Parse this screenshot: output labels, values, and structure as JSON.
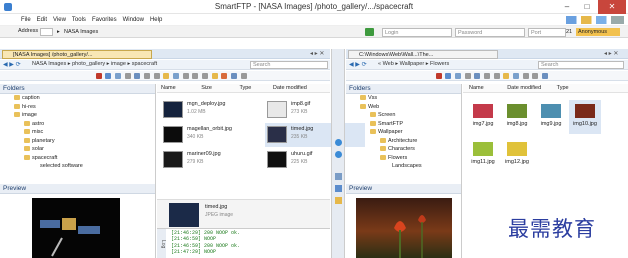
{
  "window": {
    "title": "SmartFTP - [NASA Images] /photo_gallery/.../spacecraft",
    "minimize": "–",
    "maximize": "□",
    "close": "✕"
  },
  "menu": [
    "File",
    "Edit",
    "View",
    "Tools",
    "Favorites",
    "Window",
    "Help"
  ],
  "addressbar": {
    "label": "Address",
    "value": "NASA Images",
    "login_placeholder": "Login",
    "password_placeholder": "Password",
    "port_label": "Port",
    "port_value": "21",
    "anon": "Anonymous"
  },
  "left": {
    "tab": "[NASA Images] /photo_gallery/...",
    "breadcrumb": [
      "NASA Images",
      "photo_gallery",
      "image",
      "spacecraft"
    ],
    "search_placeholder": "Search",
    "folders_title": "Folders",
    "folders": [
      {
        "name": "caption",
        "indent": 1
      },
      {
        "name": "hi-res",
        "indent": 1
      },
      {
        "name": "image",
        "indent": 1
      },
      {
        "name": "astro",
        "indent": 2
      },
      {
        "name": "misc",
        "indent": 2
      },
      {
        "name": "planetary",
        "indent": 2
      },
      {
        "name": "solar",
        "indent": 2
      },
      {
        "name": "spacecraft",
        "indent": 2
      }
    ],
    "folders_more": "selected software",
    "columns": {
      "name": "Name",
      "size": "Size",
      "type": "Type",
      "date": "Date modified"
    },
    "files": [
      {
        "name": "mgn_deploy.jpg",
        "size": "1.02 MB"
      },
      {
        "name": "magellan_orbit.jpg",
        "size": "340 KB"
      },
      {
        "name": "mariner09.jpg",
        "size": "279 KB"
      },
      {
        "name": "imp8.gif",
        "size": "273 KB"
      },
      {
        "name": "timed.jpg",
        "size": "235 KB"
      },
      {
        "name": "uhuru.gif",
        "size": "225 KB"
      }
    ],
    "preview_title": "Preview",
    "detail": {
      "name": "timed.jpg",
      "type": "JPEG image"
    },
    "log_label": "Log",
    "log": [
      "[21:46:29] 200 NOOP ok.",
      "[21:46:59] NOOP",
      "[21:46:59] 200 NOOP ok.",
      "[21:47:29] NOOP"
    ]
  },
  "right": {
    "tab": "C:\\Windows\\Web\\Wall...\\The...",
    "breadcrumb": [
      "« Web",
      "Wallpaper",
      "Flowers"
    ],
    "search_placeholder": "Search",
    "folders_title": "Folders",
    "folders": [
      {
        "name": "Vss",
        "indent": 1
      },
      {
        "name": "Web",
        "indent": 1
      },
      {
        "name": "Screen",
        "indent": 2
      },
      {
        "name": "SmartFTP",
        "indent": 2
      },
      {
        "name": "Wallpaper",
        "indent": 2
      },
      {
        "name": "Architecture",
        "indent": 3
      },
      {
        "name": "Characters",
        "indent": 3
      },
      {
        "name": "Flowers",
        "indent": 3
      }
    ],
    "folders_more": "Landscapes",
    "columns": {
      "name": "Name",
      "date": "Date modified",
      "type": "Type"
    },
    "files": [
      "img7.jpg",
      "img8.jpg",
      "img9.jpg",
      "img10.jpg",
      "img11.jpg",
      "img12.jpg"
    ],
    "preview_title": "Preview"
  },
  "watermark": "最需教育",
  "colors": {
    "accent": "#1e3f6e",
    "tab_active": "#f8e7b5",
    "log": "#1a7a1a"
  }
}
